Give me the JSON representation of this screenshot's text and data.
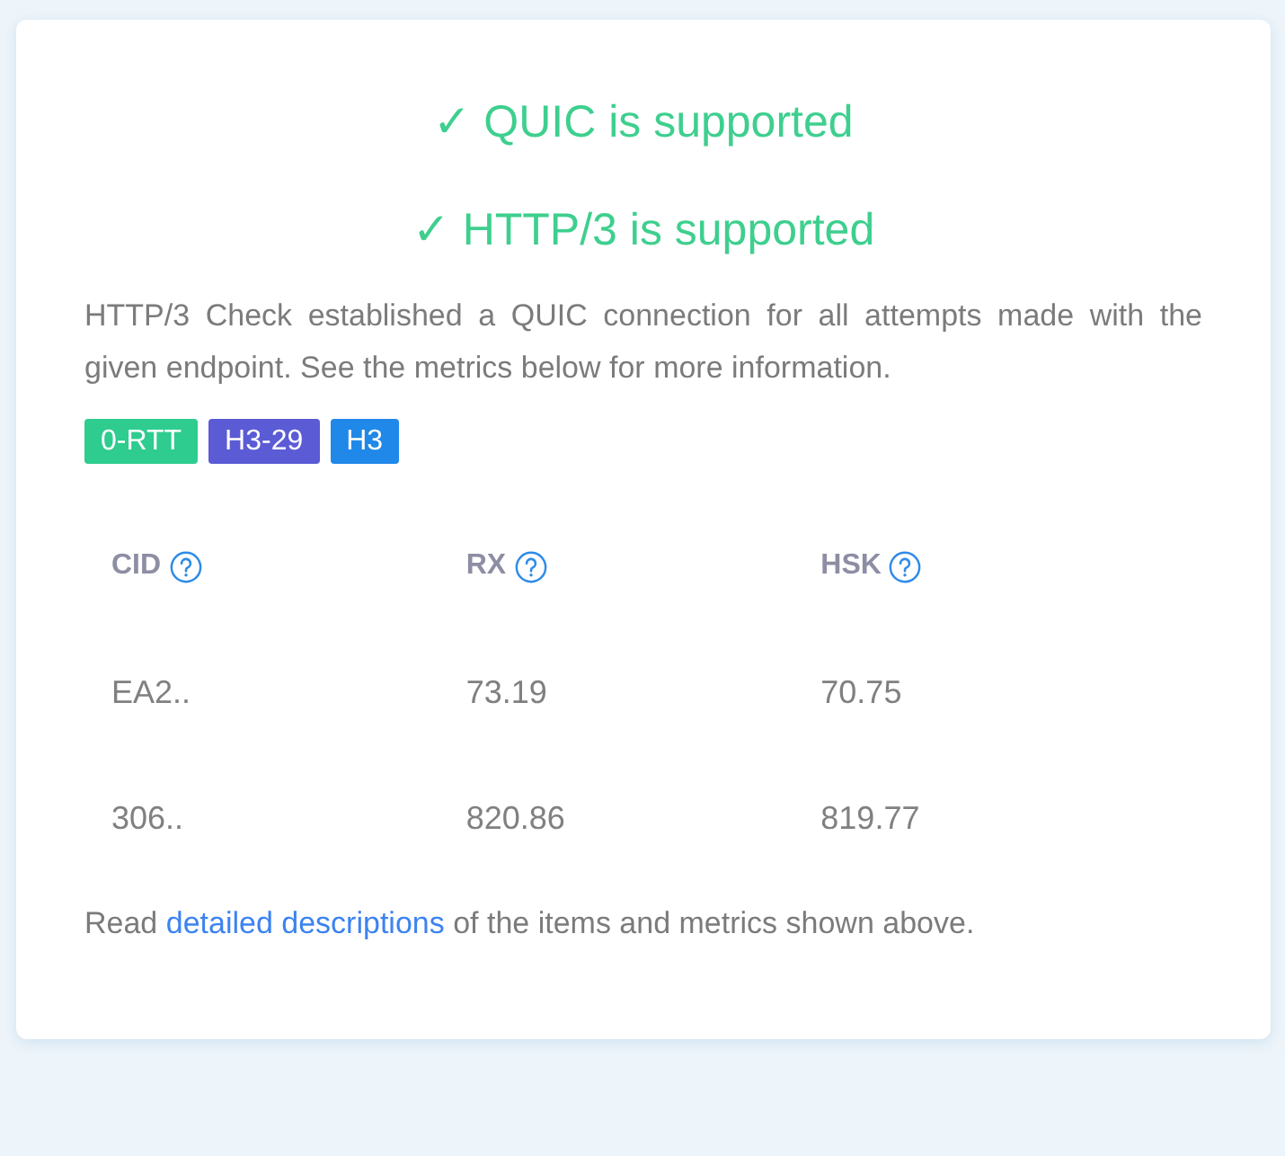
{
  "results": [
    {
      "text": "✓ QUIC is supported"
    },
    {
      "text": "✓ HTTP/3 is supported"
    }
  ],
  "summary": "HTTP/3 Check established a QUIC connection for all attempts made with the given endpoint. See the metrics below for more information.",
  "badges": [
    {
      "label": "0-RTT",
      "color": "#2ecc8f"
    },
    {
      "label": "H3-29",
      "color": "#5b5bd6"
    },
    {
      "label": "H3",
      "color": "#2088e8"
    }
  ],
  "table": {
    "columns": [
      "CID",
      "RX",
      "HSK"
    ],
    "rows": [
      [
        "EA2..",
        "73.19",
        "70.75"
      ],
      [
        "306..",
        "820.86",
        "819.77"
      ]
    ]
  },
  "footer": {
    "before": "Read ",
    "link": "detailed descriptions",
    "after": " of the items and metrics shown above."
  }
}
